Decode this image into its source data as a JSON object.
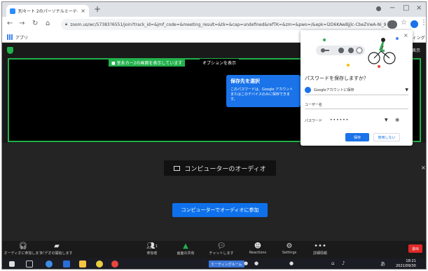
{
  "browser": {
    "tab_title": "別々ート 2のパーソナルミーティング ル",
    "url": "zoom.us/wc/57383?6551/join?track_id=&jmf_code=&meeting_result=&tk=&cap=undefined&refTK=&zm=&pwo=/&epk=l2D6KAwBjjlc-CbeZVwA-Ni_9...",
    "bookmarks_label": "アプリ",
    "reading_list": "リーディングリスト"
  },
  "zoom": {
    "view_button": "表示",
    "share_label": "■ 室永カー2の画面を表示しています",
    "view_options": "オプションを表示",
    "audio_header": "コンピューターのオーディオ",
    "join_audio": "コンピューターでオーディオに参加",
    "controls": {
      "audio": "オーディオに参加します",
      "video": "ビデオの開始します",
      "participants": "参加者",
      "participants_count": "1",
      "share": "画面の共有",
      "chat": "チャットします",
      "reactions": "Reactions",
      "settings": "Settings",
      "more": "詳細情報",
      "leave": "退出"
    }
  },
  "taskbar": {
    "zoom_item": "ミーティングルーム",
    "time": "18:21",
    "date": "2021/09/30"
  },
  "password_popup": {
    "title": "パスワードを保存しますか？",
    "account_option": "Googleアカウントに保存",
    "username_label": "ユーザー名",
    "password_label": "パスワード",
    "password_value": "••••••",
    "save_button": "保存",
    "never_button": "使用しない"
  },
  "tooltip": {
    "title": "保存先を選択",
    "body": "このパスワードは、Google アカウントまたはこのデバイスのみに保存できます。"
  },
  "colors": {
    "zoom_blue": "#0e71eb",
    "share_green": "#22b14c",
    "google_blue": "#1a73e8",
    "leave_red": "#e02828"
  }
}
